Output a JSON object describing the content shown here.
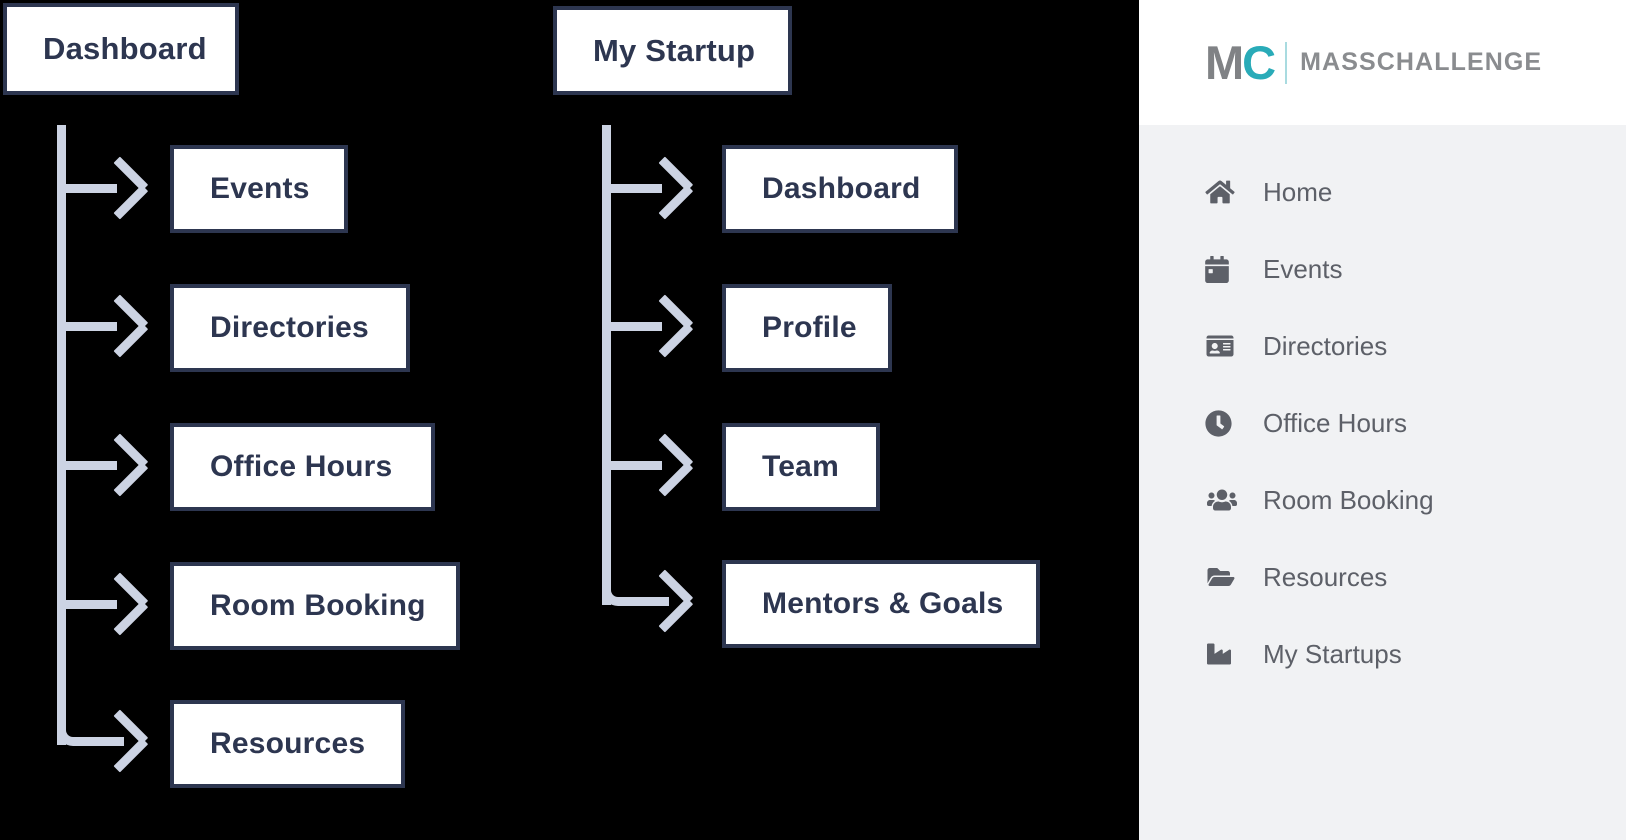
{
  "diagram": {
    "columns": [
      {
        "root": {
          "label": "Dashboard"
        },
        "children": [
          {
            "label": "Events"
          },
          {
            "label": "Directories"
          },
          {
            "label": "Office Hours"
          },
          {
            "label": "Room Booking"
          },
          {
            "label": "Resources"
          }
        ]
      },
      {
        "root": {
          "label": "My Startup"
        },
        "children": [
          {
            "label": "Dashboard"
          },
          {
            "label": "Profile"
          },
          {
            "label": "Team"
          },
          {
            "label": "Mentors & Goals"
          }
        ]
      }
    ],
    "colors": {
      "canvas": "#000000",
      "node_fill": "#ffffff",
      "node_border": "#2d3650",
      "node_text": "#2d3650",
      "connector": "#ccd3e3"
    }
  },
  "sidebar": {
    "logo": {
      "mark_m": "M",
      "mark_c": "C",
      "wordmark": "MASSCHALLENGE",
      "color_m": "#808285",
      "color_c": "#29abb8",
      "color_word": "#8a8c8f"
    },
    "background": "#f1f2f4",
    "items": [
      {
        "label": "Home",
        "icon": "home-icon"
      },
      {
        "label": "Events",
        "icon": "calendar-icon"
      },
      {
        "label": "Directories",
        "icon": "id-card-icon"
      },
      {
        "label": "Office Hours",
        "icon": "clock-icon"
      },
      {
        "label": "Room Booking",
        "icon": "users-icon"
      },
      {
        "label": "Resources",
        "icon": "open-folder-icon"
      },
      {
        "label": "My Startups",
        "icon": "factory-icon"
      }
    ]
  }
}
